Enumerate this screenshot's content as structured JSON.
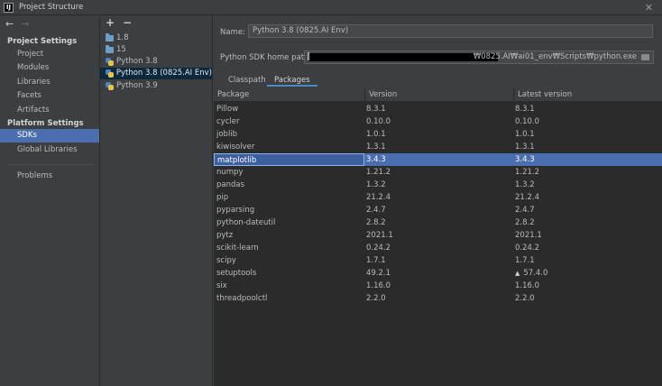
{
  "window": {
    "logo_text": "IJ",
    "title": "Project Structure",
    "close": "✕"
  },
  "nav": {
    "back": "←",
    "forward": "→",
    "project_settings_title": "Project Settings",
    "project_items": [
      "Project",
      "Modules",
      "Libraries",
      "Facets",
      "Artifacts"
    ],
    "platform_settings_title": "Platform Settings",
    "platform_items": [
      "SDKs",
      "Global Libraries"
    ],
    "selected": "SDKs",
    "other_items": [
      "Problems"
    ]
  },
  "sdk_list": {
    "add": "+",
    "remove": "−",
    "items": [
      {
        "label": "1.8",
        "icon": "folder-icon"
      },
      {
        "label": "15",
        "icon": "folder-icon"
      },
      {
        "label": "Python 3.8",
        "icon": "python-icon"
      },
      {
        "label": "Python 3.8 (0825.AI Env)",
        "icon": "python-icon",
        "selected": true
      },
      {
        "label": "Python 3.9",
        "icon": "python-icon"
      }
    ]
  },
  "detail": {
    "name_label": "Name:",
    "name_value": "Python 3.8 (0825.AI Env)",
    "home_path_label": "Python SDK home path:",
    "home_path_prefix": "‖",
    "home_path_suffix": "₩0825.AI₩ai01_env₩Scripts₩python.exe",
    "tabs": [
      "Classpath",
      "Packages"
    ],
    "active_tab": "Packages"
  },
  "packages": {
    "columns": [
      "Package",
      "Version",
      "Latest version"
    ],
    "rows": [
      {
        "name": "Pillow",
        "version": "8.3.1",
        "latest": "8.3.1"
      },
      {
        "name": "cycler",
        "version": "0.10.0",
        "latest": "0.10.0"
      },
      {
        "name": "joblib",
        "version": "1.0.1",
        "latest": "1.0.1"
      },
      {
        "name": "kiwisolver",
        "version": "1.3.1",
        "latest": "1.3.1"
      },
      {
        "name": "matplotlib",
        "version": "3.4.3",
        "latest": "3.4.3",
        "selected": true
      },
      {
        "name": "numpy",
        "version": "1.21.2",
        "latest": "1.21.2"
      },
      {
        "name": "pandas",
        "version": "1.3.2",
        "latest": "1.3.2"
      },
      {
        "name": "pip",
        "version": "21.2.4",
        "latest": "21.2.4"
      },
      {
        "name": "pyparsing",
        "version": "2.4.7",
        "latest": "2.4.7"
      },
      {
        "name": "python-dateutil",
        "version": "2.8.2",
        "latest": "2.8.2"
      },
      {
        "name": "pytz",
        "version": "2021.1",
        "latest": "2021.1"
      },
      {
        "name": "scikit-learn",
        "version": "0.24.2",
        "latest": "0.24.2"
      },
      {
        "name": "scipy",
        "version": "1.7.1",
        "latest": "1.7.1"
      },
      {
        "name": "setuptools",
        "version": "49.2.1",
        "latest": "57.4.0",
        "upgrade": "▲"
      },
      {
        "name": "six",
        "version": "1.16.0",
        "latest": "1.16.0"
      },
      {
        "name": "threadpoolctl",
        "version": "2.2.0",
        "latest": "2.2.0"
      }
    ]
  },
  "colors": {
    "selection": "#4b6eaf",
    "sdk_selection": "#0d293e",
    "background": "#3c3f41",
    "table_bg": "#2b2b2b"
  }
}
